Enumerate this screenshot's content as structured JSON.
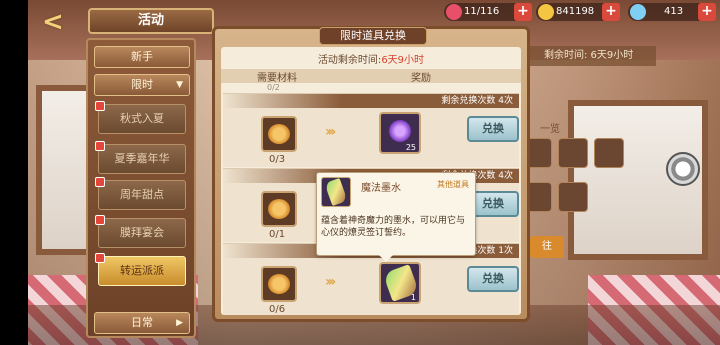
{
  "header": {
    "back_label": "<",
    "title": "活动"
  },
  "currency": [
    {
      "icon": "heart-icon",
      "value": "11/116",
      "color": "#e8506a"
    },
    {
      "icon": "coin-icon",
      "value": "841198",
      "color": "#f4c542"
    },
    {
      "icon": "gem-icon",
      "value": "413",
      "color": "#7ecff2"
    }
  ],
  "menu": {
    "tab_new": "新手",
    "tab_limited": "限时",
    "tab_daily": "日常",
    "items": [
      "秋式入夏",
      "夏季嘉年华",
      "周年甜点",
      "膜拜宴会",
      "转运派派"
    ]
  },
  "dialog": {
    "title": "限时道具兑换",
    "timer_label": "活动剩余时间:",
    "timer_value": "6天9小时",
    "col_material": "需要材料",
    "col_reward": "奖励",
    "scroll_stub": "0/2",
    "rows": [
      {
        "remain": "剩余兑换次数 4次",
        "count": "0/3",
        "reward_qty": "25",
        "exchange": "兑换"
      },
      {
        "remain": "剩余兑换次数 4次",
        "count": "0/1",
        "reward_qty": "",
        "exchange": "兑换"
      },
      {
        "remain": "剩余兑换次数 1次",
        "count": "0/6",
        "reward_qty": "1",
        "exchange": "兑换"
      }
    ]
  },
  "tooltip": {
    "name": "魔法墨水",
    "category": "其他道具",
    "description": "蕴含着神奇魔力的墨水，可以用它与心仪的燎灵签订誓约。"
  },
  "background": {
    "remain_time": "剩余时间: 6天9小时",
    "list_label": "一览",
    "orange_btn": "往"
  }
}
